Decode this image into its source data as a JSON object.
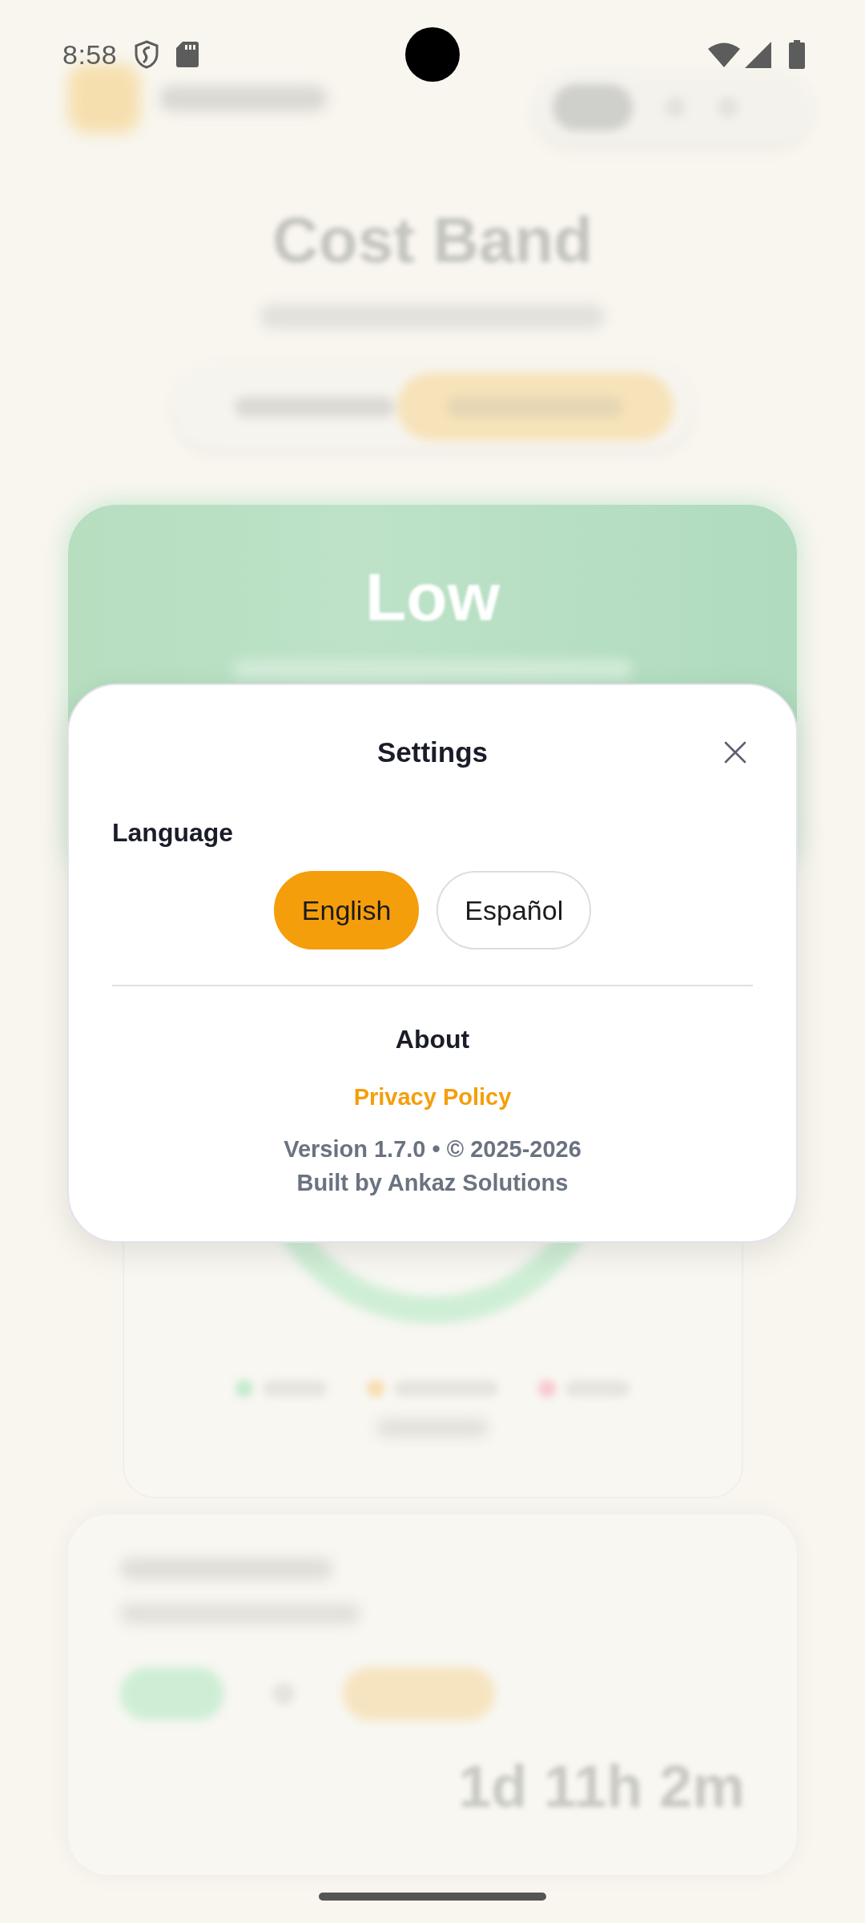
{
  "status_bar": {
    "time": "8:58"
  },
  "background": {
    "title": "Cost Band",
    "band": "Low",
    "countdown": "1d 11h 2m"
  },
  "dialog": {
    "title": "Settings",
    "language": {
      "label": "Language",
      "options": [
        {
          "label": "English",
          "selected": true
        },
        {
          "label": "Español",
          "selected": false
        }
      ]
    },
    "about": {
      "heading": "About",
      "privacy_link": "Privacy Policy",
      "version": "Version 1.7.0 • © 2025-2026",
      "credit": "Built by Ankaz Solutions"
    }
  }
}
